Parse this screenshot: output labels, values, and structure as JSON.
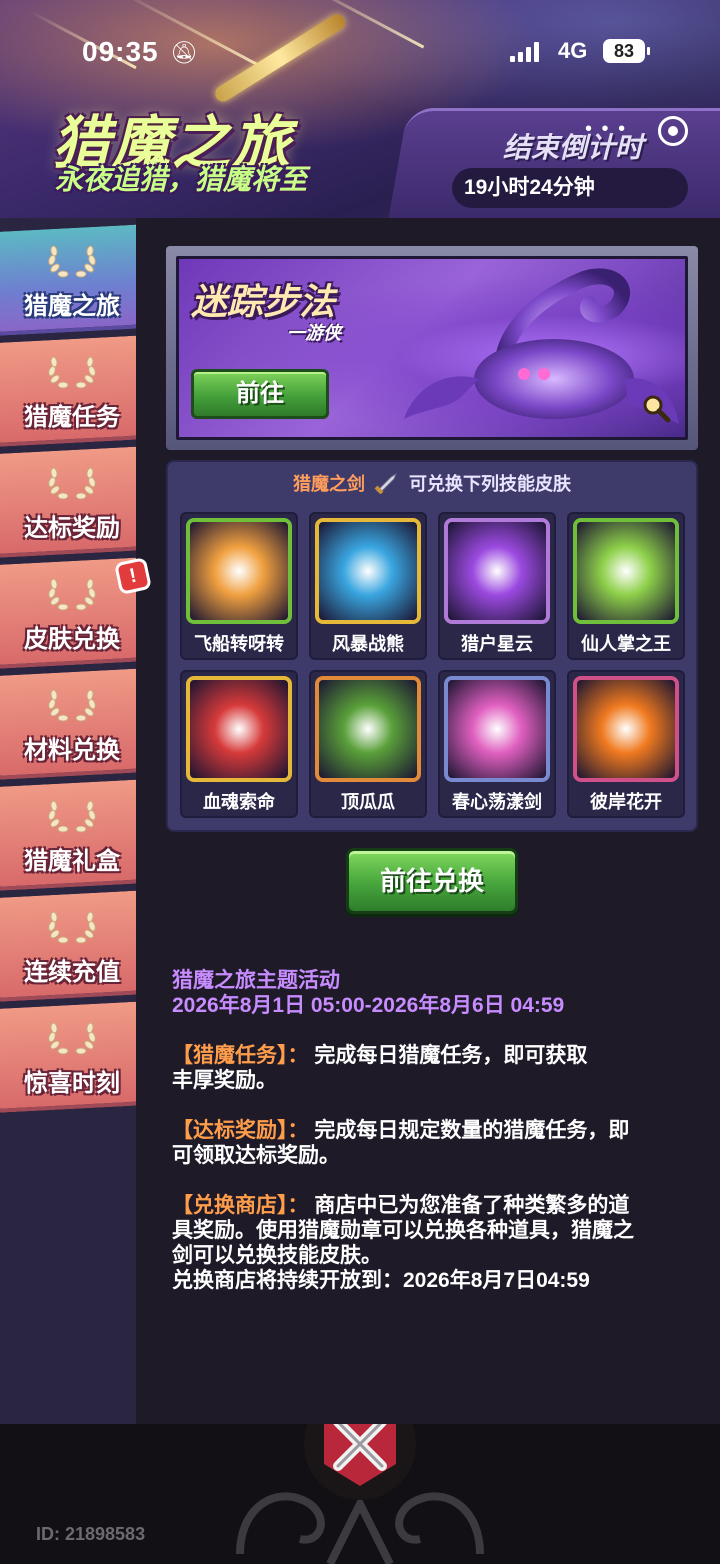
{
  "status_bar": {
    "time": "09:35",
    "network": "4G",
    "battery": "83"
  },
  "banner": {
    "title": "猎魔之旅",
    "subtitle": "永夜追猎，猎魔将至",
    "countdown_label": "结束倒计时",
    "countdown_value": "19小时24分钟"
  },
  "sidebar": {
    "items": [
      {
        "label": "猎魔之旅",
        "active": true
      },
      {
        "label": "猎魔任务",
        "active": false
      },
      {
        "label": "达标奖励",
        "active": false
      },
      {
        "label": "皮肤兑换",
        "active": false,
        "badge": "!"
      },
      {
        "label": "材料兑换",
        "active": false
      },
      {
        "label": "猎魔礼盒",
        "active": false
      },
      {
        "label": "连续充值",
        "active": false
      },
      {
        "label": "惊喜时刻",
        "active": false
      }
    ]
  },
  "hero": {
    "title": "迷踪步法",
    "subtitle": "一游侠",
    "go_label": "前往"
  },
  "skin_panel": {
    "header_highlight": "猎魔之剑",
    "header_text": "可兑换下列技能皮肤",
    "skins": [
      {
        "name": "飞船转呀转",
        "frame": "#6fbf3a",
        "theme": "#f0a040",
        "icon": "spaceship-icon"
      },
      {
        "name": "风暴战熊",
        "frame": "#e5b83a",
        "theme": "#3aa6e0",
        "icon": "storm-bear-icon"
      },
      {
        "name": "猎户星云",
        "frame": "#b07ad8",
        "theme": "#9b4ae0",
        "icon": "nebula-icon"
      },
      {
        "name": "仙人掌之王",
        "frame": "#6fbf3a",
        "theme": "#8ed04a",
        "icon": "cactus-icon"
      },
      {
        "name": "血魂索命",
        "frame": "#e5b83a",
        "theme": "#d63a3a",
        "icon": "blood-soul-icon"
      },
      {
        "name": "顶瓜瓜",
        "frame": "#e08a3a",
        "theme": "#5aa03a",
        "icon": "watermelon-icon"
      },
      {
        "name": "春心荡漾剑",
        "frame": "#7a8ad0",
        "theme": "#e060c0",
        "icon": "heart-sword-icon"
      },
      {
        "name": "彼岸花开",
        "frame": "#d0508a",
        "theme": "#f07a20",
        "icon": "flame-flower-icon"
      }
    ]
  },
  "exchange_button": "前往兑换",
  "description": {
    "activity_title": "猎魔之旅主题活动",
    "activity_period": "2026年8月1日 05:00-2026年8月6日 04:59",
    "sections": [
      {
        "heading": "【猎魔任务】：",
        "text_line1": "完成每日猎魔任务，即可获取",
        "text_line2": "丰厚奖励。"
      },
      {
        "heading": "【达标奖励】：",
        "text_line1": "完成每日规定数量的猎魔任务，即",
        "text_line2": "可领取达标奖励。"
      },
      {
        "heading": "【兑换商店】：",
        "text_line1": "商店中已为您准备了种类繁多的道",
        "text_line2": "具奖励。使用猎魔勋章可以兑换各种道具，猎魔之",
        "text_line3": "剑可以兑换技能皮肤。"
      }
    ],
    "store_open_until": "兑换商店将持续开放到：2026年8月7日04:59"
  },
  "footer": {
    "id_text": "ID: 21898583"
  }
}
